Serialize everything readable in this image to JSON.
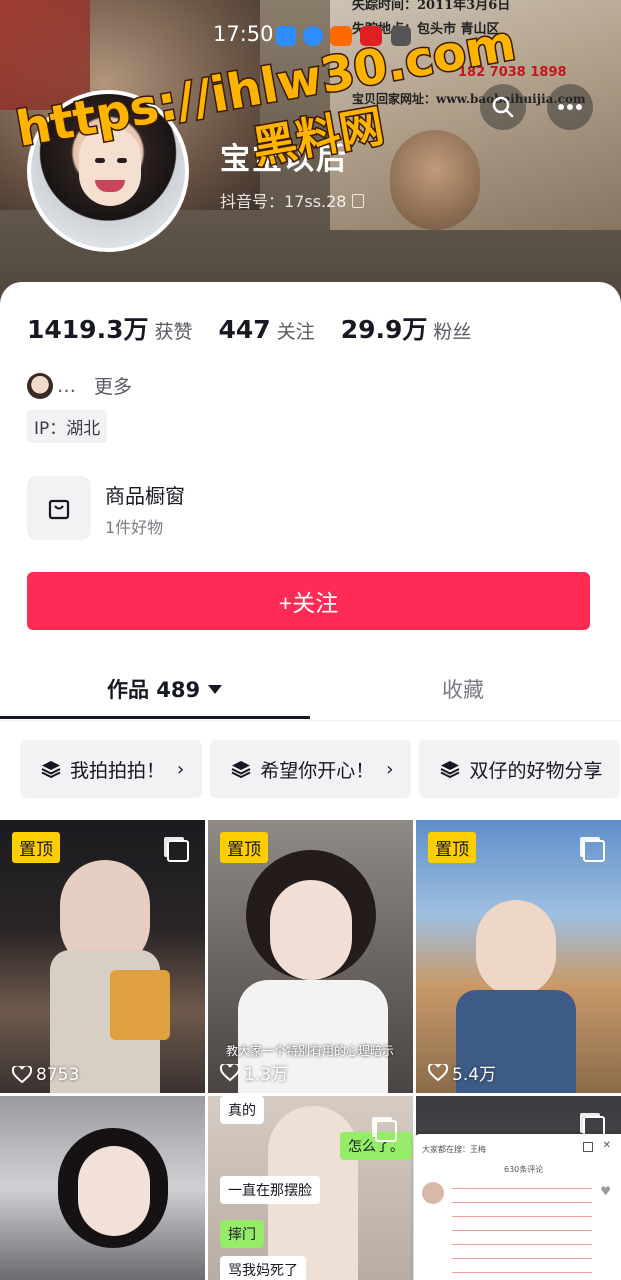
{
  "status_bar": {
    "time": "17:50"
  },
  "banner": {
    "poster_lines": [
      "失踪时间：2011年3月6日",
      "失踪地点：包头市 青山区",
      "182 7038 1898",
      "宝贝回家网址：www.baobeihuijia.com"
    ],
    "watermark_url": "https://ihlw30.com",
    "watermark_brand": "黑料网"
  },
  "profile": {
    "nickname": "宝宝以后",
    "douyin_id": "抖音号：17ss.28"
  },
  "stats": [
    {
      "value": "1419.3万",
      "label": "获赞"
    },
    {
      "value": "447",
      "label": "关注"
    },
    {
      "value": "29.9万",
      "label": "粉丝"
    }
  ],
  "bio": {
    "ellipsis": "…",
    "more": "更多"
  },
  "ip": "IP：湖北",
  "shop": {
    "title": "商品橱窗",
    "subtitle": "1件好物"
  },
  "follow_button": "+关注",
  "tabs": {
    "works": "作品 489",
    "favorites": "收藏"
  },
  "collections": [
    {
      "label": "我拍拍拍！"
    },
    {
      "label": "希望你开心！"
    },
    {
      "label": "双仔的好物分享"
    }
  ],
  "videos": [
    {
      "pinned": "置顶",
      "likes": "8753",
      "caption": ""
    },
    {
      "pinned": "置顶",
      "likes": "1.3万",
      "caption": "教大家一个特别有用的心理暗示"
    },
    {
      "pinned": "置顶",
      "likes": "5.4万",
      "caption": ""
    },
    {
      "pinned": "",
      "likes": "",
      "caption": ""
    },
    {
      "pinned": "",
      "likes": "",
      "bubbles": [
        "真的",
        "怎么了。",
        "一直在那摆脸",
        "摔门",
        "骂我妈死了"
      ]
    },
    {
      "pinned": "",
      "likes": "",
      "note_title": "大家都在搜：王梅",
      "note_count": "630条评论"
    }
  ],
  "colors": {
    "accent": "#fe2c55",
    "pin": "#fece00",
    "watermark": "#ffb400"
  }
}
